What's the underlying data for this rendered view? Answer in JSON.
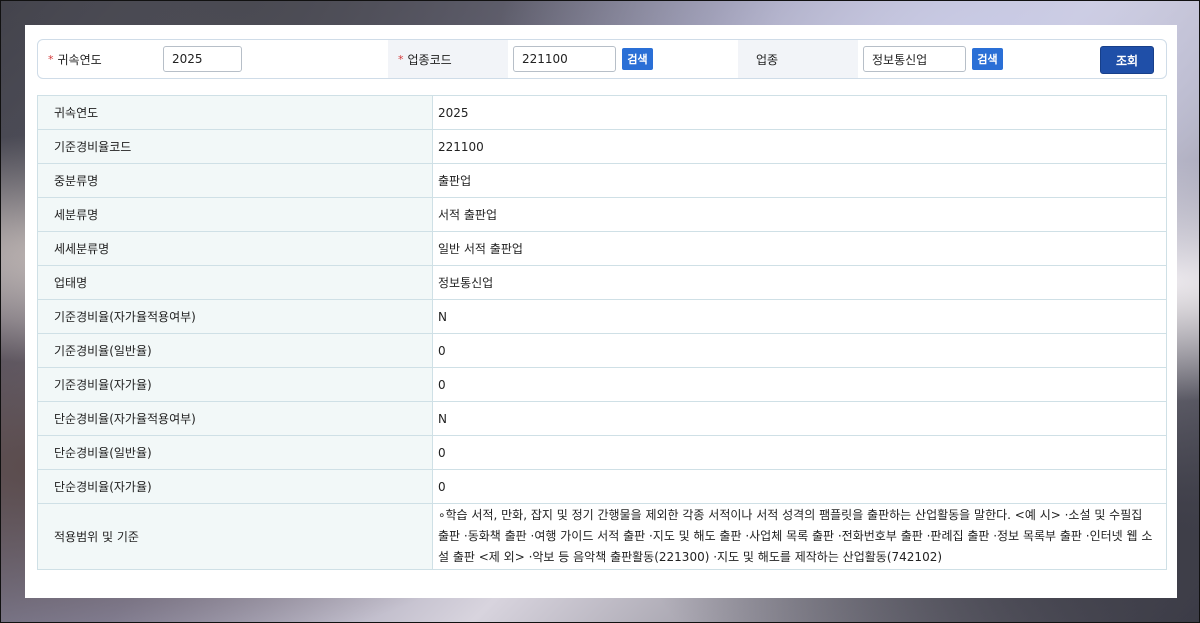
{
  "search": {
    "year_label": "귀속연도",
    "year_value": "2025",
    "code_label": "업종코드",
    "code_value": "221100",
    "code_search_btn": "검색",
    "industry_label": "업종",
    "industry_value": "정보통신업",
    "industry_search_btn": "검색",
    "query_btn": "조회",
    "required_mark": "*"
  },
  "rows": [
    {
      "label": "귀속연도",
      "value": "2025"
    },
    {
      "label": "기준경비율코드",
      "value": "221100"
    },
    {
      "label": "중분류명",
      "value": "출판업"
    },
    {
      "label": "세분류명",
      "value": "서적 출판업"
    },
    {
      "label": "세세분류명",
      "value": "일반 서적 출판업"
    },
    {
      "label": "업태명",
      "value": "정보통신업"
    },
    {
      "label": "기준경비율(자가율적용여부)",
      "value": "N"
    },
    {
      "label": "기준경비율(일반율)",
      "value": "0"
    },
    {
      "label": "기준경비율(자가율)",
      "value": "0"
    },
    {
      "label": "단순경비율(자가율적용여부)",
      "value": "N"
    },
    {
      "label": "단순경비율(일반율)",
      "value": "0"
    },
    {
      "label": "단순경비율(자가율)",
      "value": "0"
    },
    {
      "label": "적용범위 및 기준",
      "value": "∘학습 서적, 만화, 잡지 및 정기 간행물을 제외한 각종 서적이나 서적 성격의 팸플릿을 출판하는 산업활동을 말한다. <예 시> ·소설 및 수필집 출판 ·동화책 출판 ·여행 가이드 서적 출판 ·지도 및 해도 출판 ·사업체 목록 출판 ·전화번호부 출판 ·판례집 출판 ·정보 목록부 출판 ·인터넷 웹 소설 출판 <제 외> ·악보 등 음악책 출판활동(221300) ·지도 및 해도를 제작하는 산업활동(742102)"
    }
  ],
  "colors": {
    "accent_button": "#2a6fd6",
    "query_button": "#1f4fa8",
    "header_cell_bg": "#f2f8f8",
    "required": "#d43a3a"
  }
}
